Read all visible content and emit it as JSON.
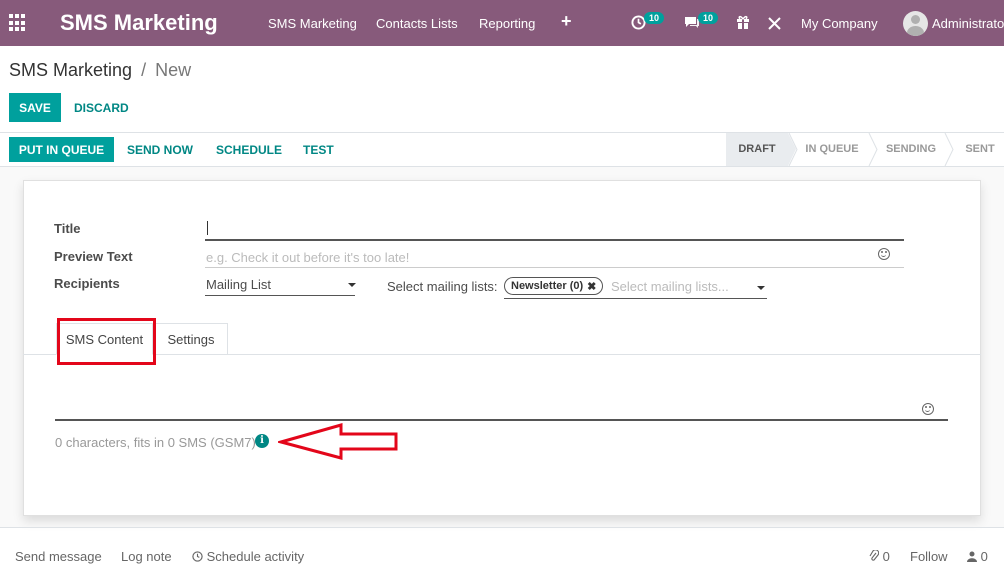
{
  "navbar": {
    "brand": "SMS Marketing",
    "menu": [
      "SMS Marketing",
      "Contacts Lists",
      "Reporting"
    ],
    "activity_count": "10",
    "messages_count": "10",
    "company": "My Company",
    "user": "Administrator",
    "color": "#875a7b"
  },
  "breadcrumb": {
    "parent": "SMS Marketing",
    "separator": "/",
    "current": "New"
  },
  "actions": {
    "save": "SAVE",
    "discard": "DISCARD"
  },
  "header_buttons": {
    "put_in_queue": "PUT IN QUEUE",
    "send_now": "SEND NOW",
    "schedule": "SCHEDULE",
    "test": "TEST"
  },
  "statusbar": [
    "DRAFT",
    "IN QUEUE",
    "SENDING",
    "SENT"
  ],
  "form": {
    "title_label": "Title",
    "title_value": "",
    "preview_label": "Preview Text",
    "preview_placeholder": "e.g. Check it out before it's too late!",
    "recipients_label": "Recipients",
    "recipients_value": "Mailing List",
    "mailing_lists_label": "Select mailing lists:",
    "mailing_list_tag": "Newsletter (0)",
    "mailing_lists_placeholder": "Select mailing lists...",
    "tabs": [
      "SMS Content",
      "Settings"
    ],
    "sms_counter": "0 characters, fits in 0 SMS (GSM7)"
  },
  "chatter": {
    "send_message": "Send message",
    "log_note": "Log note",
    "schedule_activity": "Schedule activity",
    "attachments": "0",
    "follow": "Follow",
    "followers": "0"
  },
  "colors": {
    "primary": "#00a09d",
    "annotation": "#e3061a"
  }
}
